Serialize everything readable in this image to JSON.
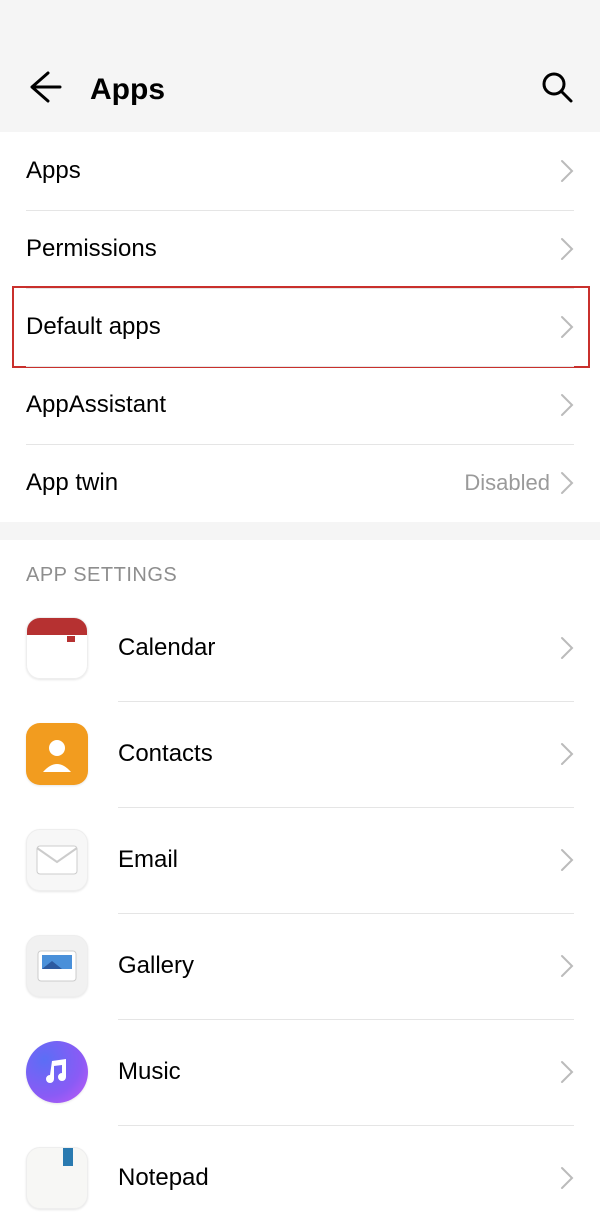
{
  "header": {
    "title": "Apps"
  },
  "menu": [
    {
      "label": "Apps",
      "value": ""
    },
    {
      "label": "Permissions",
      "value": ""
    },
    {
      "label": "Default apps",
      "value": "",
      "highlighted": true
    },
    {
      "label": "AppAssistant",
      "value": ""
    },
    {
      "label": "App twin",
      "value": "Disabled"
    }
  ],
  "section_header": "APP SETTINGS",
  "apps": [
    {
      "label": "Calendar",
      "icon": "calendar-icon"
    },
    {
      "label": "Contacts",
      "icon": "contacts-icon"
    },
    {
      "label": "Email",
      "icon": "email-icon"
    },
    {
      "label": "Gallery",
      "icon": "gallery-icon"
    },
    {
      "label": "Music",
      "icon": "music-icon"
    },
    {
      "label": "Notepad",
      "icon": "notepad-icon"
    }
  ]
}
